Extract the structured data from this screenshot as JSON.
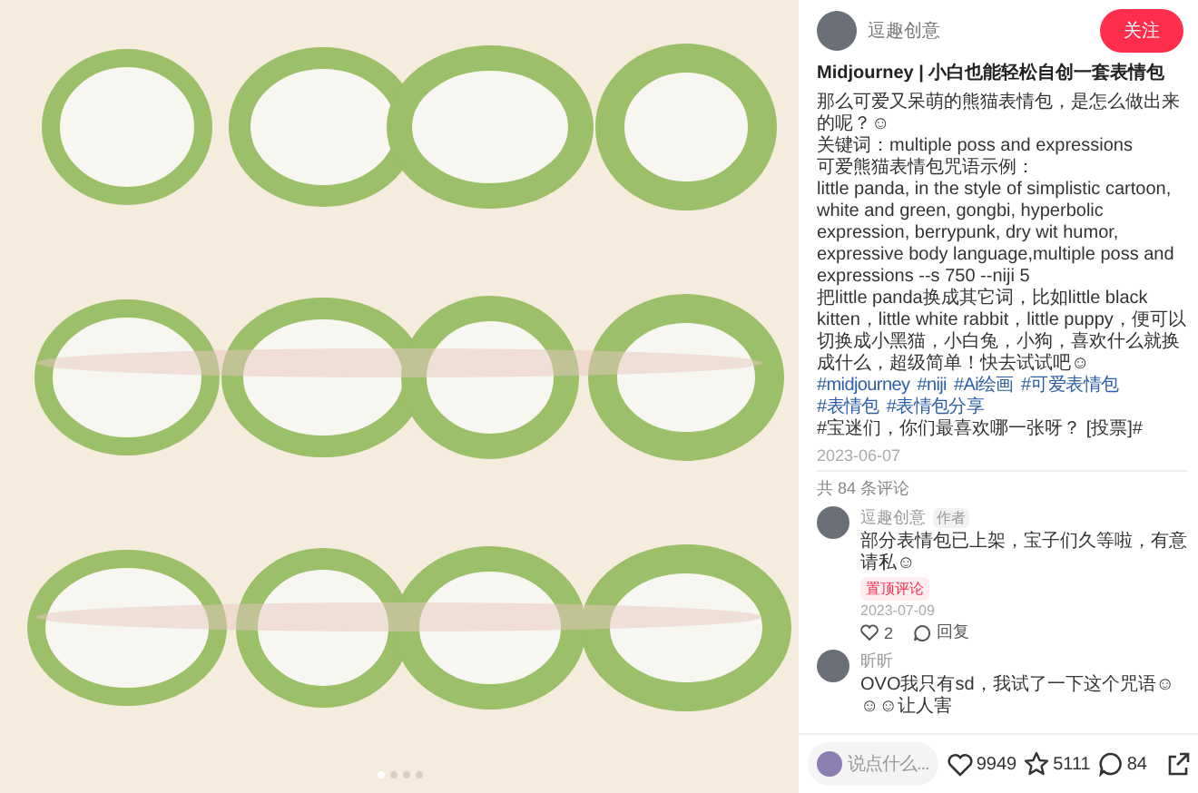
{
  "pager": [
    {
      "selected": true
    },
    {
      "selected": false
    },
    {
      "selected": false
    },
    {
      "selected": false
    }
  ],
  "author": {
    "name": "逗趣创意",
    "follow": "关注"
  },
  "post": {
    "title": "Midjourney | 小白也能轻松自创一套表情包",
    "paragraphs": [
      "那么可爱又呆萌的熊猫表情包，是怎么做出来的呢？☺",
      "关键词：multiple poss and expressions",
      "可爱熊猫表情包咒语示例：",
      "little panda, in the style of simplistic cartoon, white and green, gongbi, hyperbolic expression, berrypunk, dry wit humor, expressive body language,multiple poss and expressions --s 750 --niji 5",
      "把little panda换成其它词，比如little black kitten，little white rabbit，little puppy，便可以切换成小黑猫，小白兔，小狗，喜欢什么就换成什么，超级简单！快去试试吧☺"
    ],
    "tags": [
      "#midjourney",
      "#niji",
      "#Ai绘画",
      "#可爱表情包",
      "#表情包",
      "#表情包分享"
    ],
    "question": "#宝迷们，你们最喜欢哪一张呀？ [投票]#",
    "date": "2023-06-07"
  },
  "comments_count": "共 84 条评论",
  "comments": [
    {
      "name": "逗趣创意",
      "badge": "作者",
      "text": "部分表情包已上架，宝子们久等啦，有意请私☺",
      "pinned": "置顶评论",
      "date": "2023-07-09",
      "likes": "2",
      "reply": "回复"
    },
    {
      "name": "昕昕",
      "text": "OVO我只有sd，我试了一下这个咒语☺☺☺让人害"
    }
  ],
  "bottom_bar": {
    "placeholder": "说点什么...",
    "likes": "9949",
    "stars": "5111",
    "comments": "84"
  }
}
